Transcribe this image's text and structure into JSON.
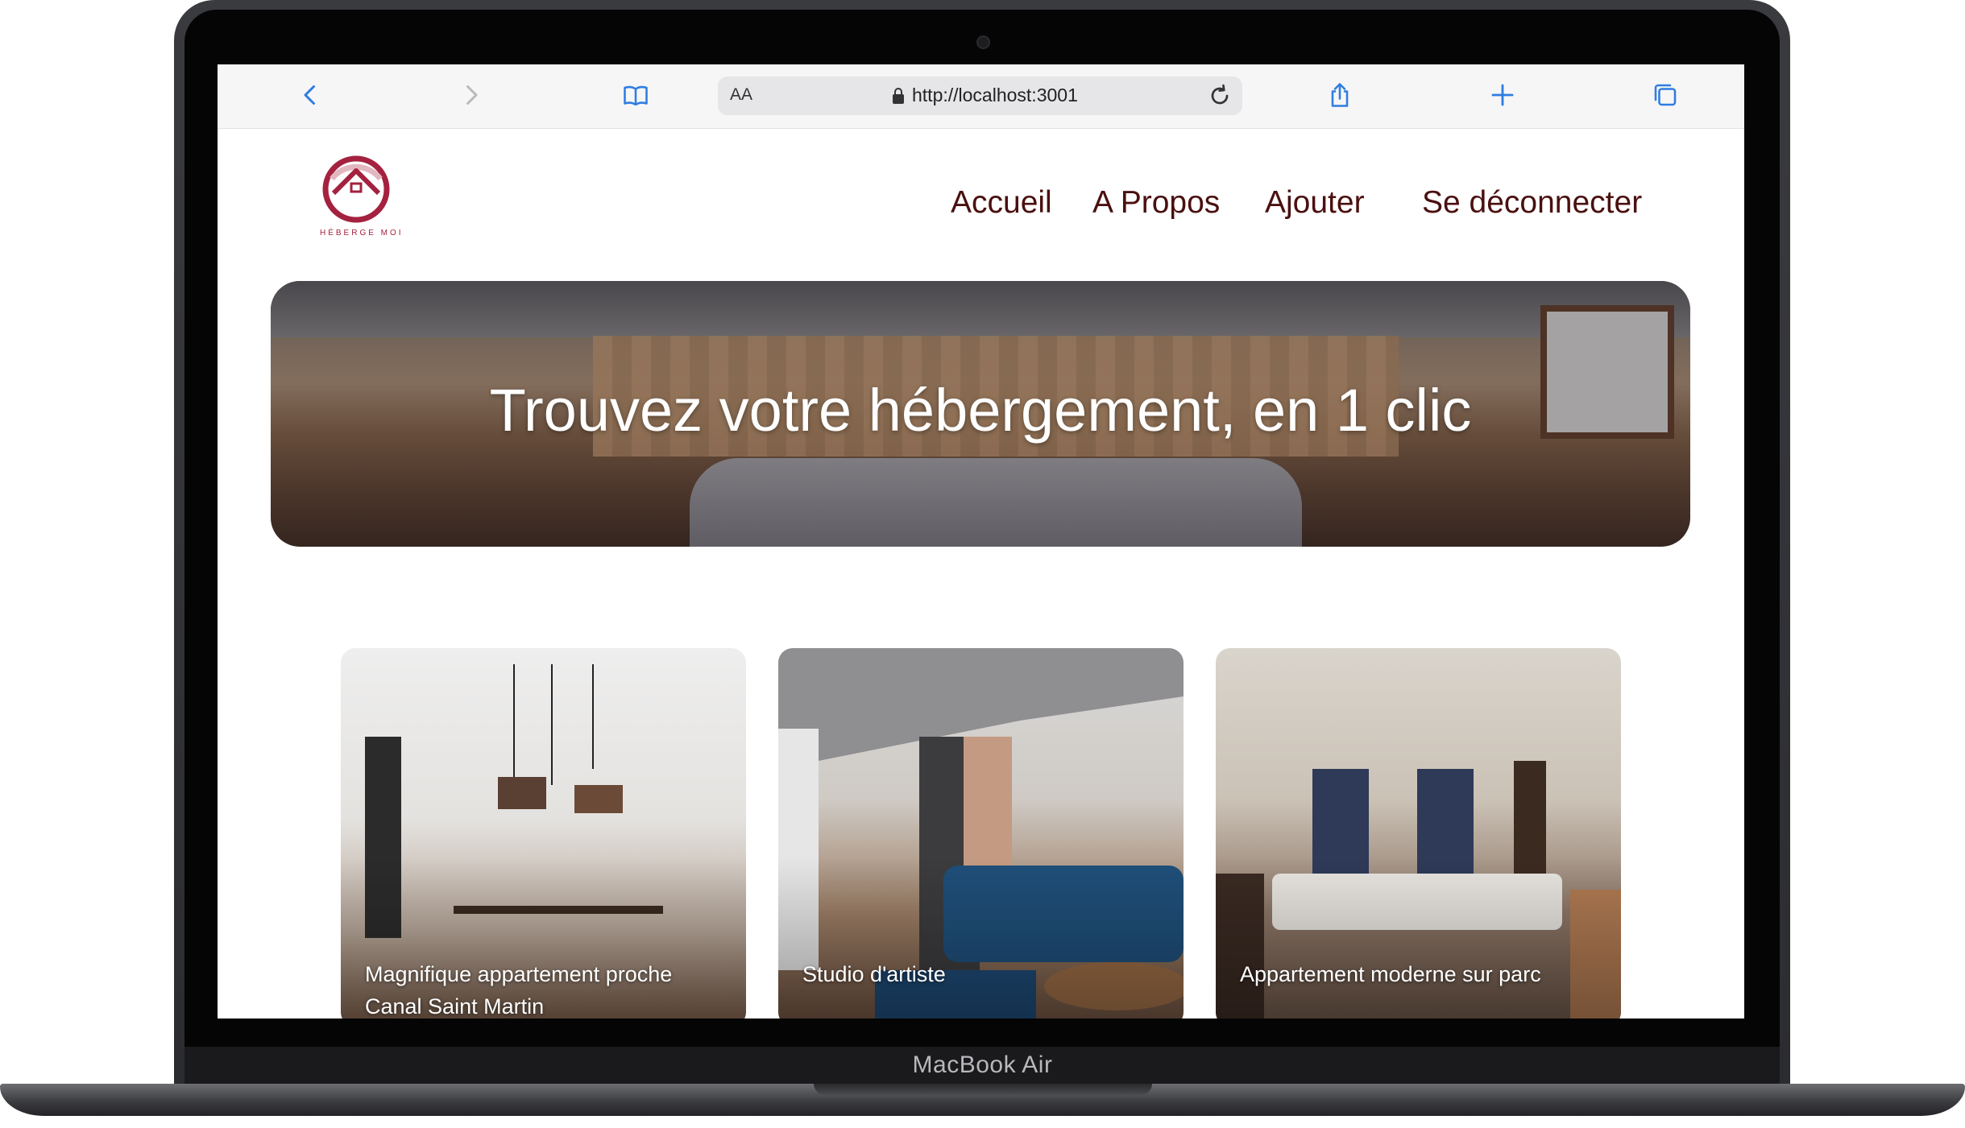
{
  "device": {
    "label": "MacBook Air"
  },
  "browser": {
    "url": "http://localhost:3001",
    "text_size_label": "AA"
  },
  "site": {
    "logo_text": "HÉBERGE MOI",
    "nav": [
      {
        "label": "Accueil"
      },
      {
        "label": "A Propos"
      },
      {
        "label": "Ajouter"
      },
      {
        "label": "Se déconnecter"
      }
    ],
    "hero_title": "Trouvez votre hébergement, en 1 clic",
    "listings": [
      {
        "title": "Magnifique appartement proche Canal Saint Martin"
      },
      {
        "title": "Studio d'artiste"
      },
      {
        "title": "Appartement moderne sur parc"
      }
    ]
  },
  "colors": {
    "brand": "#a4223f",
    "nav_text": "#4a1010",
    "toolbar_icons": "#2f7de1"
  }
}
